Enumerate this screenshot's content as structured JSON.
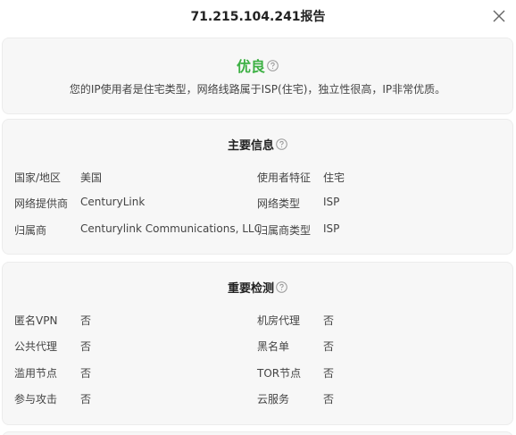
{
  "dialog": {
    "title": "71.215.104.241报告",
    "close_icon": "close-icon"
  },
  "verdict": {
    "label": "优良",
    "color": "#3cb043",
    "description": "您的IP使用者是住宅类型，网络线路属于ISP(住宅)，独立性很高，IP非常优质。",
    "help_icon": "question-circle-icon"
  },
  "main_info": {
    "title": "主要信息",
    "help_icon": "question-circle-icon",
    "rows": [
      {
        "label_left": "国家/地区",
        "value_left": "美国",
        "label_right": "使用者特征",
        "value_right": "住宅"
      },
      {
        "label_left": "网络提供商",
        "value_left": "CenturyLink",
        "label_right": "网络类型",
        "value_right": "ISP"
      },
      {
        "label_left": "归属商",
        "value_left": "Centurylink Communications, LLC",
        "label_right": "归属商类型",
        "value_right": "ISP"
      }
    ]
  },
  "checks": {
    "title": "重要检测",
    "help_icon": "question-circle-icon",
    "rows": [
      {
        "label_left": "匿名VPN",
        "value_left": "否",
        "label_right": "机房代理",
        "value_right": "否"
      },
      {
        "label_left": "公共代理",
        "value_left": "否",
        "label_right": "黑名单",
        "value_right": "否"
      },
      {
        "label_left": "滥用节点",
        "value_left": "否",
        "label_right": "TOR节点",
        "value_right": "否"
      },
      {
        "label_left": "参与攻击",
        "value_left": "否",
        "label_right": "云服务",
        "value_right": "否"
      }
    ]
  }
}
